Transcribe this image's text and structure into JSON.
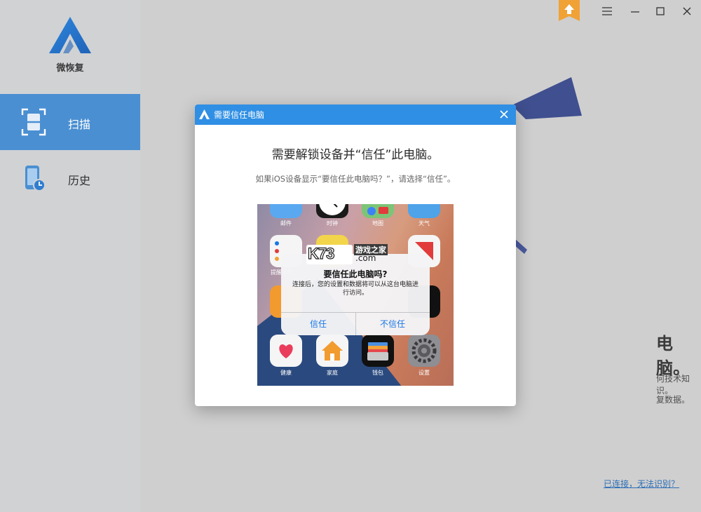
{
  "app": {
    "name": "微恢复"
  },
  "sidebar": {
    "items": [
      {
        "label": "扫描",
        "icon": "scan-icon",
        "active": true
      },
      {
        "label": "历史",
        "icon": "history-icon",
        "active": false
      }
    ]
  },
  "background": {
    "heading_fragment": "电脑。",
    "line1_fragment": "何技术知识。",
    "line2_fragment": "复数据。",
    "bottom_link": "已连接，无法识别？"
  },
  "dialog": {
    "title": "需要信任电脑",
    "heading": "需要解锁设备并“信任”此电脑。",
    "subtitle": "如果iOS设备显示“要信任此电脑吗？”，请选择“信任”。",
    "phone": {
      "apps": [
        {
          "label": "邮件"
        },
        {
          "label": "时钟"
        },
        {
          "label": "地图"
        },
        {
          "label": "天气"
        },
        {
          "label": "提醒事项"
        },
        {
          "label": "健康"
        },
        {
          "label": "家庭"
        },
        {
          "label": "钱包"
        },
        {
          "label": "设置"
        }
      ],
      "alert": {
        "title": "要信任此电脑吗?",
        "message": "连接后，您的设置和数据将可以从这台电脑进行访问。",
        "trust_button": "信任",
        "dont_trust_button": "不信任"
      },
      "watermark": {
        "brand": "K73",
        "site": "游戏之家",
        "domain": ".com"
      }
    }
  },
  "colors": {
    "accent": "#2f8fe4",
    "sidebar_active": "#4a8fd2",
    "link": "#2d6fb7",
    "badge": "#f0a236"
  }
}
